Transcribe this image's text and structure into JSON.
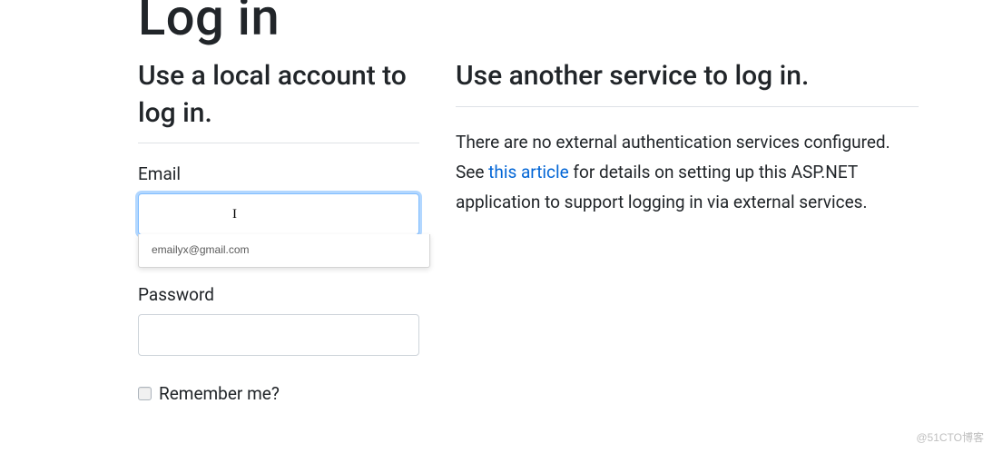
{
  "page": {
    "title": "Log in"
  },
  "local": {
    "heading": "Use a local account to log in.",
    "email_label": "Email",
    "email_value": "",
    "password_label": "Password",
    "password_value": "",
    "remember_label": "Remember me?"
  },
  "autocomplete": {
    "suggestion": "emailyx@gmail.com"
  },
  "external": {
    "heading": "Use another service to log in.",
    "text_before": "There are no external authentication services configured. See ",
    "link_text": "this article",
    "text_after": " for details on setting up this ASP.NET application to support logging in via external services."
  },
  "watermark": "@51CTO博客"
}
